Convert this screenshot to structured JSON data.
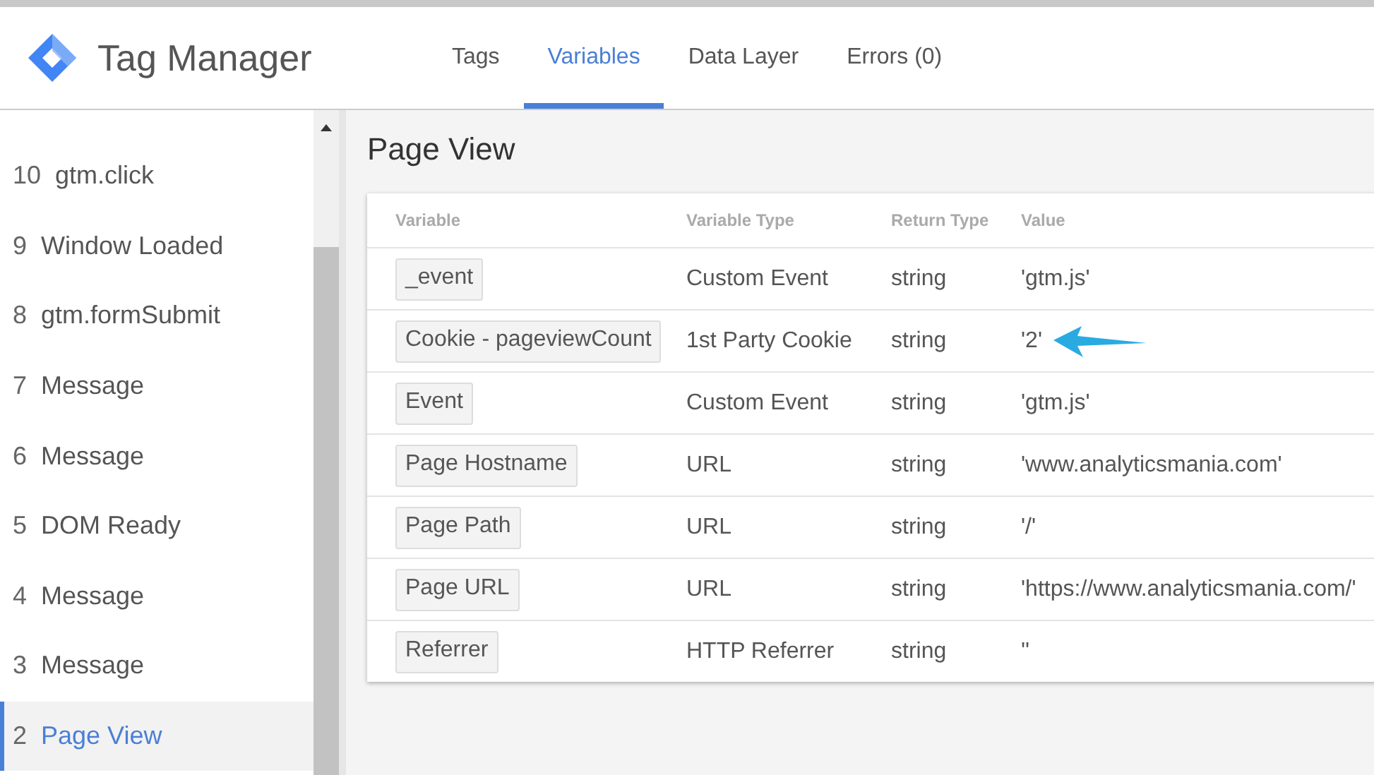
{
  "app": {
    "title": "Tag Manager"
  },
  "tabs": [
    {
      "label": "Tags",
      "selected": false
    },
    {
      "label": "Variables",
      "selected": true
    },
    {
      "label": "Data Layer",
      "selected": false
    },
    {
      "label": "Errors (0)",
      "selected": false
    }
  ],
  "events": [
    {
      "number": "10",
      "name": "gtm.click",
      "selected": false
    },
    {
      "number": "9",
      "name": "Window Loaded",
      "selected": false
    },
    {
      "number": "8",
      "name": "gtm.formSubmit",
      "selected": false
    },
    {
      "number": "7",
      "name": "Message",
      "selected": false
    },
    {
      "number": "6",
      "name": "Message",
      "selected": false
    },
    {
      "number": "5",
      "name": "DOM Ready",
      "selected": false
    },
    {
      "number": "4",
      "name": "Message",
      "selected": false
    },
    {
      "number": "3",
      "name": "Message",
      "selected": false
    },
    {
      "number": "2",
      "name": "Page View",
      "selected": true
    }
  ],
  "panel": {
    "title": "Page View"
  },
  "table": {
    "columns": [
      "Variable",
      "Variable Type",
      "Return Type",
      "Value"
    ],
    "rows": [
      {
        "variable": "_event",
        "type": "Custom Event",
        "return_type": "string",
        "value": "'gtm.js'",
        "highlighted": false
      },
      {
        "variable": "Cookie - pageviewCount",
        "type": "1st Party Cookie",
        "return_type": "string",
        "value": "'2'",
        "highlighted": true
      },
      {
        "variable": "Event",
        "type": "Custom Event",
        "return_type": "string",
        "value": "'gtm.js'",
        "highlighted": false
      },
      {
        "variable": "Page Hostname",
        "type": "URL",
        "return_type": "string",
        "value": "'www.analyticsmania.com'",
        "highlighted": false
      },
      {
        "variable": "Page Path",
        "type": "URL",
        "return_type": "string",
        "value": "'/'",
        "highlighted": false
      },
      {
        "variable": "Page URL",
        "type": "URL",
        "return_type": "string",
        "value": "'https://www.analyticsmania.com/'",
        "highlighted": false
      },
      {
        "variable": "Referrer",
        "type": "HTTP Referrer",
        "return_type": "string",
        "value": "''",
        "highlighted": false
      }
    ]
  }
}
